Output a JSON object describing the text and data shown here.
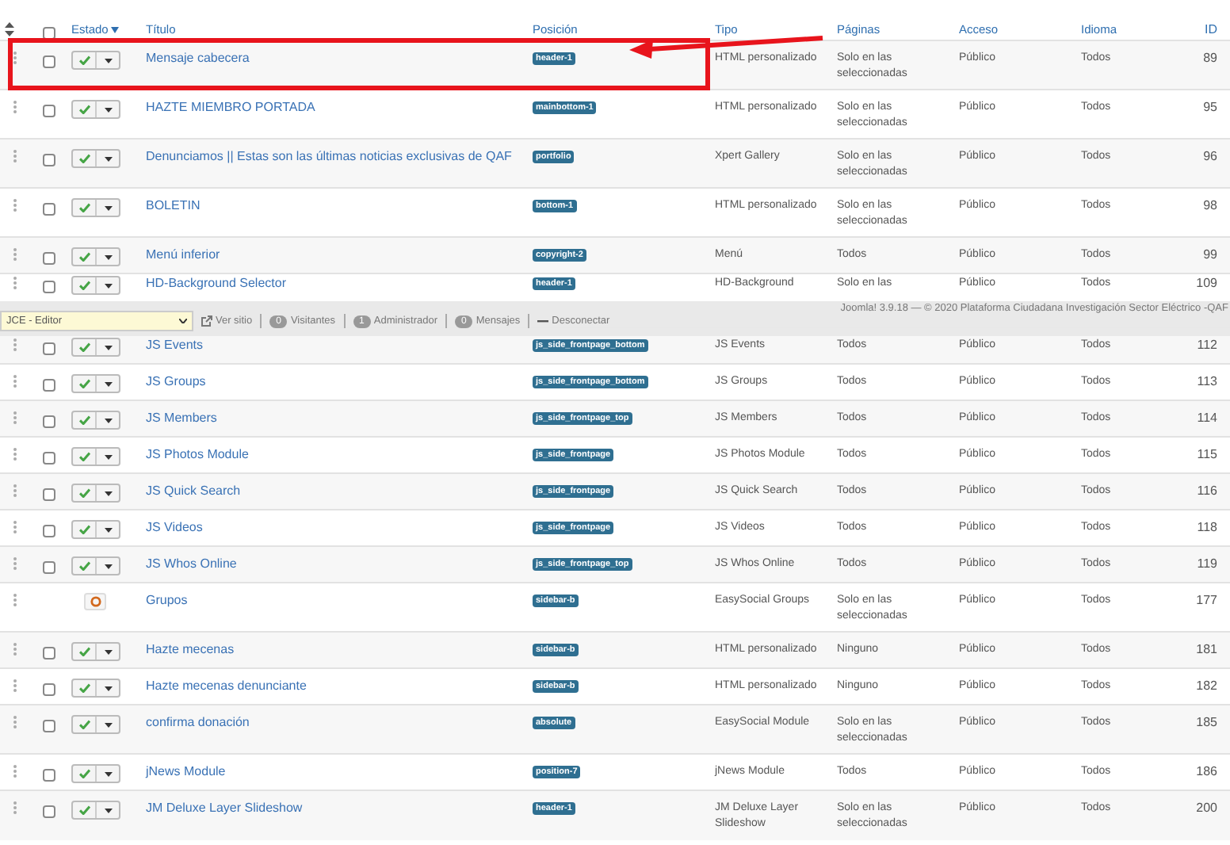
{
  "table": {
    "select_all_checked": false,
    "columns": [
      {
        "label": "Estado",
        "sorted": true
      },
      {
        "label": "Título",
        "sorted": false
      },
      {
        "label": "Posición",
        "sorted": false
      },
      {
        "label": "Tipo",
        "sorted": false
      },
      {
        "label": "Páginas",
        "sorted": false
      },
      {
        "label": "Acceso",
        "sorted": false
      },
      {
        "label": "Idioma",
        "sorted": false
      },
      {
        "label": "ID",
        "sorted": false
      }
    ],
    "rows": [
      {
        "published": true,
        "checked": false,
        "highlighted": true,
        "title": "Mensaje cabecera",
        "position": "header-1",
        "type": "HTML personalizado",
        "pages": "Solo en las seleccionadas",
        "access": "Público",
        "language": "Todos",
        "id": "89"
      },
      {
        "published": true,
        "checked": false,
        "highlighted": false,
        "title": "HAZTE MIEMBRO PORTADA",
        "position": "mainbottom-1",
        "type": "HTML personalizado",
        "pages": "Solo en las seleccionadas",
        "access": "Público",
        "language": "Todos",
        "id": "95"
      },
      {
        "published": true,
        "checked": false,
        "highlighted": false,
        "title": "Denunciamos || Estas son las últimas noticias exclusivas de QAF",
        "position": "portfolio",
        "type": "Xpert Gallery",
        "pages": "Solo en las seleccionadas",
        "access": "Público",
        "language": "Todos",
        "id": "96"
      },
      {
        "published": true,
        "checked": false,
        "highlighted": false,
        "title": "BOLETIN",
        "position": "bottom-1",
        "type": "HTML personalizado",
        "pages": "Solo en las seleccionadas",
        "access": "Público",
        "language": "Todos",
        "id": "98"
      },
      {
        "published": true,
        "checked": false,
        "highlighted": false,
        "title": "Menú inferior",
        "position": "copyright-2",
        "type": "Menú",
        "pages": "Todos",
        "access": "Público",
        "language": "Todos",
        "id": "99"
      },
      {
        "published": true,
        "checked": false,
        "highlighted": false,
        "title": "HD-Background Selector",
        "position": "header-1",
        "type": "HD-Background",
        "pages": "Solo en las",
        "access": "Público",
        "language": "Todos",
        "id": "109"
      },
      {
        "published": true,
        "checked": false,
        "highlighted": false,
        "title": "JS Events",
        "position": "js_side_frontpage_bottom",
        "type": "JS Events",
        "pages": "Todos",
        "access": "Público",
        "language": "Todos",
        "id": "112"
      },
      {
        "published": true,
        "checked": false,
        "highlighted": false,
        "title": "JS Groups",
        "position": "js_side_frontpage_bottom",
        "type": "JS Groups",
        "pages": "Todos",
        "access": "Público",
        "language": "Todos",
        "id": "113"
      },
      {
        "published": true,
        "checked": false,
        "highlighted": false,
        "title": "JS Members",
        "position": "js_side_frontpage_top",
        "type": "JS Members",
        "pages": "Todos",
        "access": "Público",
        "language": "Todos",
        "id": "114"
      },
      {
        "published": true,
        "checked": false,
        "highlighted": false,
        "title": "JS Photos Module",
        "position": "js_side_frontpage",
        "type": "JS Photos Module",
        "pages": "Todos",
        "access": "Público",
        "language": "Todos",
        "id": "115"
      },
      {
        "published": true,
        "checked": false,
        "highlighted": false,
        "title": "JS Quick Search",
        "position": "js_side_frontpage",
        "type": "JS Quick Search",
        "pages": "Todos",
        "access": "Público",
        "language": "Todos",
        "id": "116"
      },
      {
        "published": true,
        "checked": false,
        "highlighted": false,
        "title": "JS Videos",
        "position": "js_side_frontpage",
        "type": "JS Videos",
        "pages": "Todos",
        "access": "Público",
        "language": "Todos",
        "id": "118"
      },
      {
        "published": true,
        "checked": false,
        "highlighted": false,
        "title": "JS Whos Online",
        "position": "js_side_frontpage_top",
        "type": "JS Whos Online",
        "pages": "Todos",
        "access": "Público",
        "language": "Todos",
        "id": "119"
      },
      {
        "published": false,
        "highlighted": false,
        "title": "Grupos",
        "position": "sidebar-b",
        "type": "EasySocial Groups",
        "pages": "Solo en las seleccionadas",
        "access": "Público",
        "language": "Todos",
        "id": "177"
      },
      {
        "published": true,
        "checked": false,
        "highlighted": false,
        "title": "Hazte mecenas",
        "position": "sidebar-b",
        "type": "HTML personalizado",
        "pages": "Ninguno",
        "access": "Público",
        "language": "Todos",
        "id": "181"
      },
      {
        "published": true,
        "checked": false,
        "highlighted": false,
        "title": "Hazte mecenas denunciante",
        "position": "sidebar-b",
        "type": "HTML personalizado",
        "pages": "Ninguno",
        "access": "Público",
        "language": "Todos",
        "id": "182"
      },
      {
        "published": true,
        "checked": false,
        "highlighted": false,
        "title": "confirma donación",
        "position": "absolute",
        "type": "EasySocial Module",
        "pages": "Solo en las seleccionadas",
        "access": "Público",
        "language": "Todos",
        "id": "185"
      },
      {
        "published": true,
        "checked": false,
        "highlighted": false,
        "title": "jNews Module",
        "position": "position-7",
        "type": "jNews Module",
        "pages": "Todos",
        "access": "Público",
        "language": "Todos",
        "id": "186"
      },
      {
        "published": true,
        "checked": false,
        "highlighted": false,
        "title": "JM Deluxe Layer Slideshow",
        "position": "header-1",
        "type": "JM Deluxe Layer Slideshow",
        "pages": "Solo en las seleccionadas",
        "access": "Público",
        "language": "Todos",
        "id": "200"
      }
    ]
  },
  "status_bar": {
    "editor_select": "JCE - Editor",
    "links": [
      {
        "kind": "view",
        "label": "Ver sitio"
      },
      {
        "kind": "count",
        "count": "0",
        "label": "Visitantes"
      },
      {
        "kind": "count",
        "count": "1",
        "label": "Administrador"
      },
      {
        "kind": "count",
        "count": "0",
        "label": "Mensajes"
      },
      {
        "kind": "logout",
        "label": "Desconectar"
      }
    ],
    "footer": "Joomla! 3.9.18 — © 2020 Plataforma Ciudadana Investigación Sector Eléctrico -QAF"
  }
}
